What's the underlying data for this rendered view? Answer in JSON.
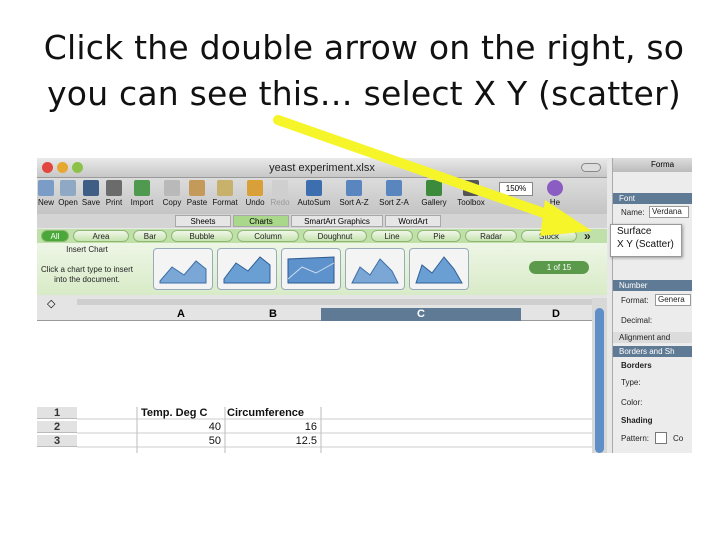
{
  "slide": {
    "title_line1": "Click the double arrow on the right, so",
    "title_line2": "you can see this… select X Y (scatter)"
  },
  "window": {
    "title": "yeast experiment.xlsx"
  },
  "toolbar": {
    "items": [
      "New",
      "Open",
      "Save",
      "Print",
      "Import",
      "Copy",
      "Paste",
      "Format",
      "Undo",
      "Redo",
      "AutoSum",
      "Sort A-Z",
      "Sort Z-A",
      "Gallery",
      "Toolbox"
    ],
    "zoom": "150%",
    "help_label": "He"
  },
  "ribbon": {
    "tabs": [
      "Sheets",
      "Charts",
      "SmartArt Graphics",
      "WordArt"
    ],
    "active_tab": "Charts"
  },
  "chart_types": [
    "All",
    "Area",
    "Bar",
    "Bubble",
    "Column",
    "Doughnut",
    "Line",
    "Pie",
    "Radar",
    "Stock"
  ],
  "gallery": {
    "insert_chart_label": "Insert Chart",
    "description": "Click a chart type to insert into the document.",
    "page_indicator": "1 of 15"
  },
  "columns": [
    "A",
    "B",
    "C",
    "D"
  ],
  "sheet": {
    "rows": [
      {
        "num": "1",
        "a": "Temp. Deg C",
        "b": "Circumference"
      },
      {
        "num": "2",
        "a": "40",
        "b": "16"
      },
      {
        "num": "3",
        "a": "50",
        "b": "12.5"
      }
    ]
  },
  "popup": {
    "items": [
      "Surface",
      "X Y (Scatter)"
    ]
  },
  "palette": {
    "title": "Forma",
    "font_section": "Font",
    "name_label": "Name:",
    "name_value": "Verdana",
    "number_section": "Number",
    "format_label": "Format:",
    "format_value": "Genera",
    "decimal_label": "Decimal:",
    "alignment_section": "Alignment and",
    "borders_section": "Borders and Sh",
    "borders_label": "Borders",
    "type_label": "Type:",
    "color_label": "Color:",
    "shading_label": "Shading",
    "pattern_label": "Pattern:",
    "pattern_value": "Co"
  },
  "colors": {
    "arrow": "#f5f52a",
    "ribbon_green": "#bfe0a8",
    "selected_column": "#5f7a94",
    "scroll_thumb": "#5e8fc8"
  }
}
